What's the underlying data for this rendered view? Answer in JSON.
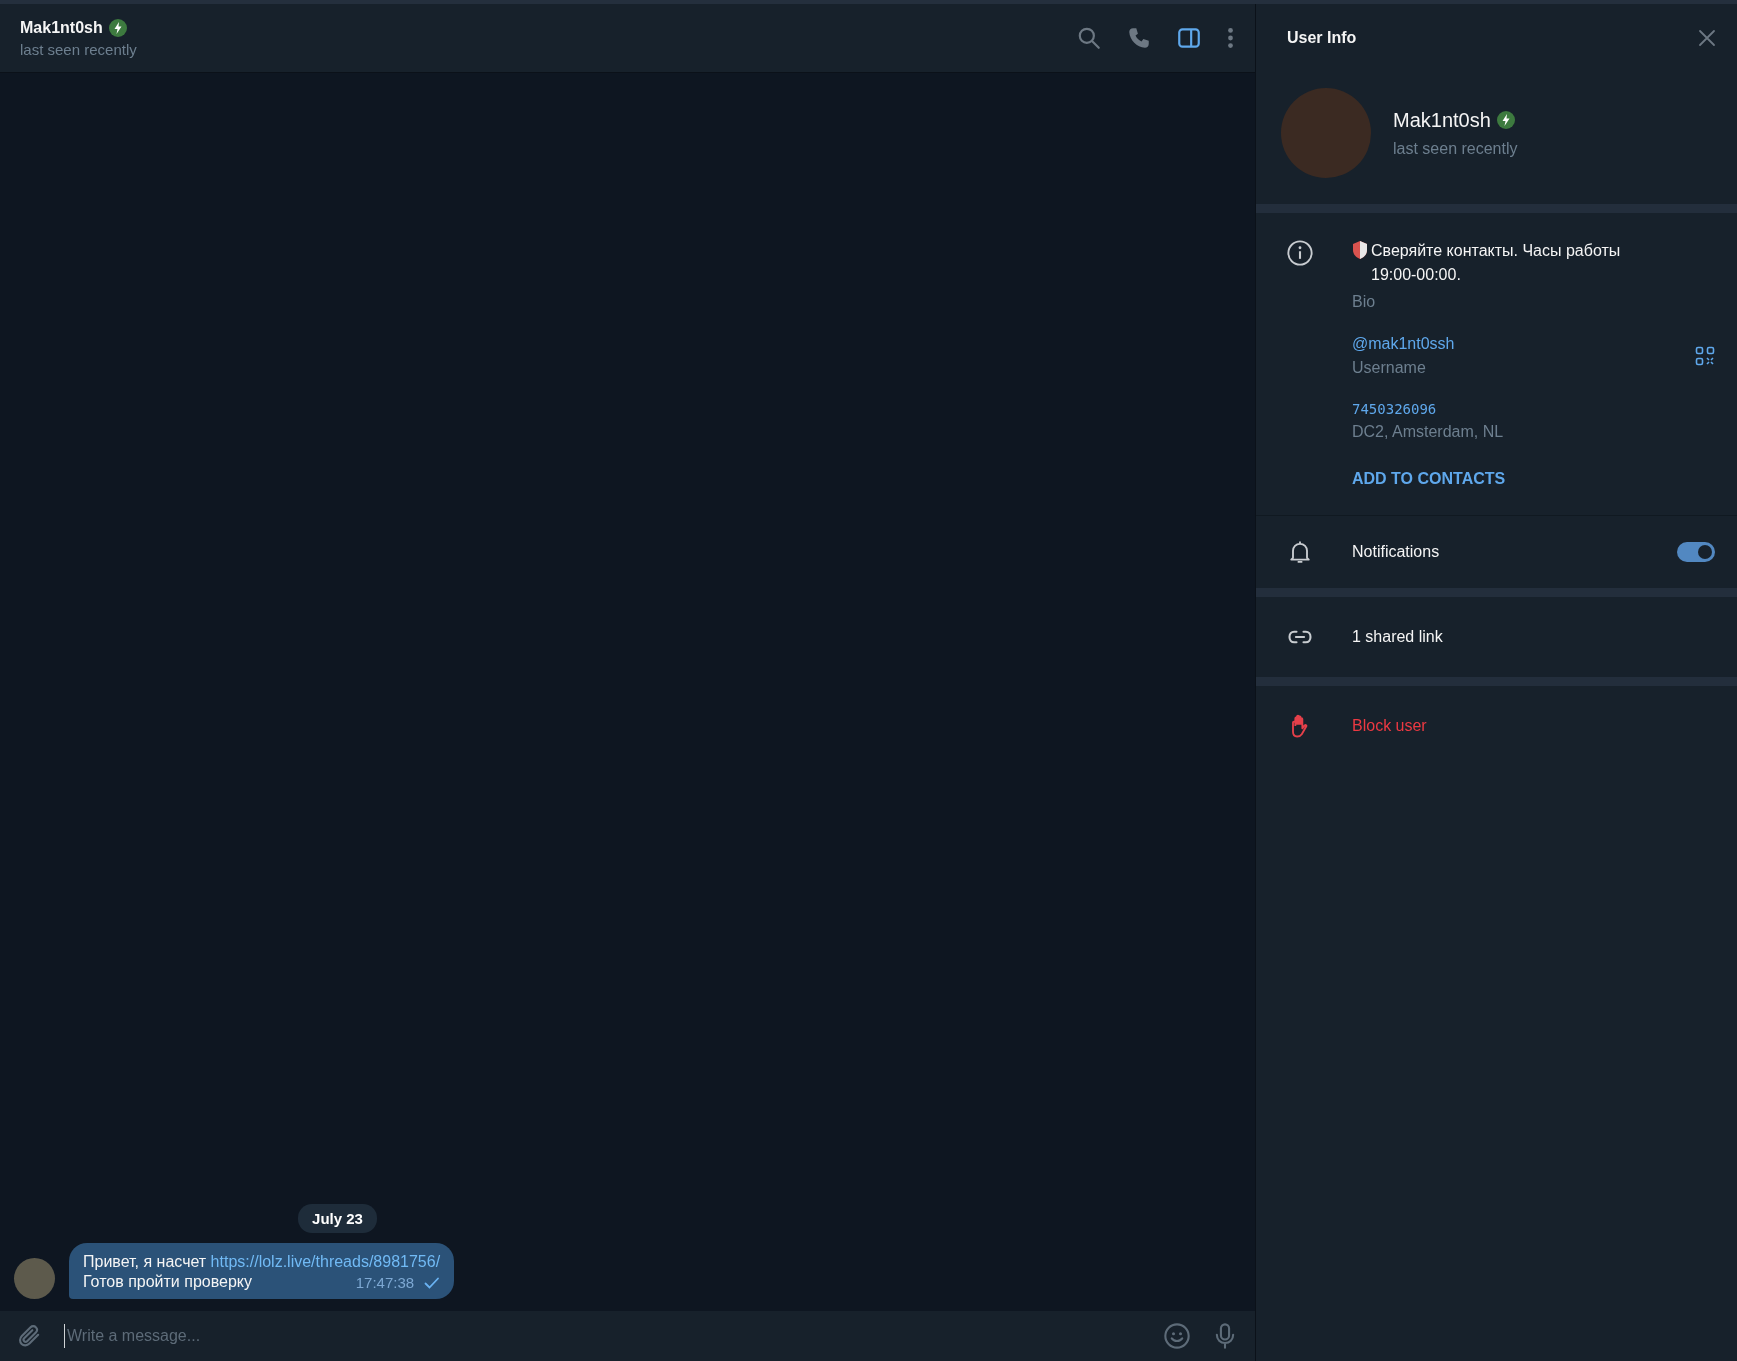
{
  "chat_header": {
    "name": "Mak1nt0sh",
    "verified": true,
    "status": "last seen recently",
    "panel_toggle_active": true
  },
  "messages": {
    "date": "July 23",
    "items": [
      {
        "text": "Привет, я насчет ",
        "link": "https://lolz.live/threads/8981756/",
        "second_line": "Готов пройти проверку",
        "time": "17:47:38",
        "read": false
      }
    ]
  },
  "composer": {
    "placeholder": "Write a message..."
  },
  "user_info": {
    "title": "User Info",
    "name": "Mak1nt0sh",
    "verified": true,
    "status": "last seen recently",
    "bio": "Сверяйте контакты. Часы работы 19:00-00:00.",
    "bio_label": "Bio",
    "username": "@mak1nt0ssh",
    "username_label": "Username",
    "user_id": "7450326096",
    "datacenter": "DC2, Amsterdam, NL",
    "add_contact": "ADD TO CONTACTS",
    "notifications": {
      "label": "Notifications",
      "on": true
    },
    "shared_links": "1 shared link",
    "block": "Block user"
  }
}
